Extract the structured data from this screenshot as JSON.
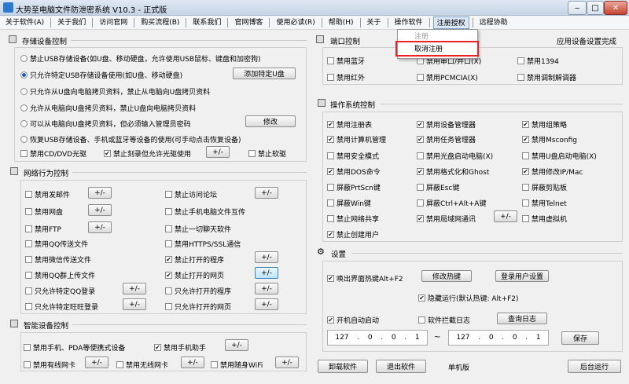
{
  "window": {
    "title": "大势至电脑文件防泄密系统 V10.3 - 正式版",
    "min": "‒",
    "max": "□",
    "close": "✕"
  },
  "menu": {
    "items": [
      "关于软件(A)",
      "关于我们",
      "访问官网",
      "购买流程(B)",
      "联系我们",
      "官网博客",
      "使用必读(R)",
      "帮助(H)",
      "关于",
      "操作软件",
      "注册授权",
      "远程协助"
    ],
    "active": "注册授权"
  },
  "dropdown": {
    "items": [
      "注册",
      "取消注册"
    ]
  },
  "storage": {
    "title": "存储设备控制",
    "options": [
      {
        "label": "禁止USB存储设备(如U盘、移动硬盘，允许使用USB鼠标、键盘和加密狗)",
        "checked": false
      },
      {
        "label": "只允许特定USB存储设备使用(如U盘、移动硬盘)",
        "checked": true
      },
      {
        "label": "只允许从U盘向电脑拷贝资料，禁止从电脑向U盘拷贝资料",
        "checked": false
      },
      {
        "label": "允许从电脑向U盘拷贝资料，禁止U盘向电脑拷贝资料",
        "checked": false
      },
      {
        "label": "可以从电脑向U盘拷贝资料，但必须输入管理员密码",
        "checked": false
      },
      {
        "label": "恢复USB存储设备、手机或蓝牙等设备的使用(可手动点击恢复设备)",
        "checked": false
      }
    ],
    "add_usb_btn": "添加特定U盘",
    "modify_btn": "修改",
    "cd_label": "禁用CD/DVD光驱",
    "burn_label": "禁止刻录但允许光驱使用",
    "burn_checked": true,
    "pm_btn": "+/-",
    "floppy_label": "禁止软驱"
  },
  "network": {
    "title": "网络行为控制",
    "pm": "+/-",
    "left": [
      {
        "label": "禁用发邮件",
        "checked": false
      },
      {
        "label": "禁用网盘",
        "checked": false
      },
      {
        "label": "禁用FTP",
        "checked": false
      },
      {
        "label": "禁用QQ传送文件",
        "checked": false
      },
      {
        "label": "禁用微信传送文件",
        "checked": false
      },
      {
        "label": "禁用QQ群上传文件",
        "checked": false
      },
      {
        "label": "只允许特定QQ登录",
        "checked": false
      },
      {
        "label": "只允许特定旺旺登录",
        "checked": false
      }
    ],
    "right": [
      {
        "label": "禁止访问论坛",
        "checked": false
      },
      {
        "label": "禁止手机电脑文件互传",
        "checked": false
      },
      {
        "label": "禁止一切聊天软件",
        "checked": false
      },
      {
        "label": "禁用HTTPS/SSL通信",
        "checked": false
      },
      {
        "label": "禁止打开的程序",
        "checked": true
      },
      {
        "label": "禁止打开的网页",
        "checked": true
      },
      {
        "label": "只允许打开的程序",
        "checked": false
      },
      {
        "label": "只允许打开的网页",
        "checked": false
      }
    ]
  },
  "smart": {
    "title": "智能设备控制",
    "phone_pda": "禁用手机、PDA等便携式设备",
    "phone_helper": "禁用手机助手",
    "phone_helper_checked": true,
    "wired": "禁用有线网卡",
    "wireless": "禁用无线网卡",
    "wifi": "禁用随身WiFi"
  },
  "port": {
    "title": "端口控制",
    "right_label": "应用设备设置完成",
    "items": [
      {
        "label": "禁用蓝牙",
        "checked": false
      },
      {
        "label": "禁用串口/并口(X)",
        "checked": false
      },
      {
        "label": "禁用1394",
        "checked": false
      },
      {
        "label": "禁用红外",
        "checked": false
      },
      {
        "label": "禁用PCMCIA(X)",
        "checked": false
      },
      {
        "label": "禁用调制解调器",
        "checked": false
      }
    ]
  },
  "os": {
    "title": "操作系统控制",
    "items": [
      {
        "label": "禁用注册表",
        "checked": true
      },
      {
        "label": "禁用设备管理器",
        "checked": true
      },
      {
        "label": "禁用组策略",
        "checked": true
      },
      {
        "label": "禁用计算机管理",
        "checked": true
      },
      {
        "label": "禁用任务管理器",
        "checked": true
      },
      {
        "label": "禁用Msconfig",
        "checked": true
      },
      {
        "label": "禁用安全模式",
        "checked": false
      },
      {
        "label": "禁用光盘启动电脑(X)",
        "checked": false
      },
      {
        "label": "禁用U盘启动电脑(X)",
        "checked": false
      },
      {
        "label": "禁用DOS命令",
        "checked": true
      },
      {
        "label": "禁用格式化和Ghost",
        "checked": true
      },
      {
        "label": "禁用修改IP/Mac",
        "checked": true
      },
      {
        "label": "屏蔽PrtScn键",
        "checked": false
      },
      {
        "label": "屏蔽Esc键",
        "checked": false
      },
      {
        "label": "屏蔽剪贴板",
        "checked": false
      },
      {
        "label": "屏蔽Win键",
        "checked": false
      },
      {
        "label": "屏蔽Ctrl+Alt+A键",
        "checked": false
      },
      {
        "label": "禁用Telnet",
        "checked": false
      },
      {
        "label": "禁止网络共享",
        "checked": false
      },
      {
        "label": "禁用局域网通讯",
        "checked": true
      },
      {
        "label": "禁用虚拟机",
        "checked": false
      },
      {
        "label": "禁止创建用户",
        "checked": true
      }
    ],
    "pm": "+/-"
  },
  "settings": {
    "title": "设置",
    "hotkey_label": "唤出界面热键Alt+F2",
    "hotkey_checked": true,
    "modify_hotkey": "修改热键",
    "login_user": "登录用户设置",
    "hidden_label": "隐藏运行(默认热键: Alt+F2)",
    "hidden_checked": true,
    "autostart_label": "开机自动启动",
    "autostart_checked": true,
    "interceptlog_label": "软件拦截日志",
    "query_log": "查询日志",
    "ip_from": [
      "127",
      "0",
      "0",
      "1"
    ],
    "tilde": "~",
    "ip_to": [
      "127",
      "0",
      "0",
      "1"
    ],
    "save": "保存"
  },
  "bottom": {
    "uninstall": "卸载软件",
    "exit": "退出软件",
    "standalone": "单机版",
    "background": "后台运行"
  }
}
